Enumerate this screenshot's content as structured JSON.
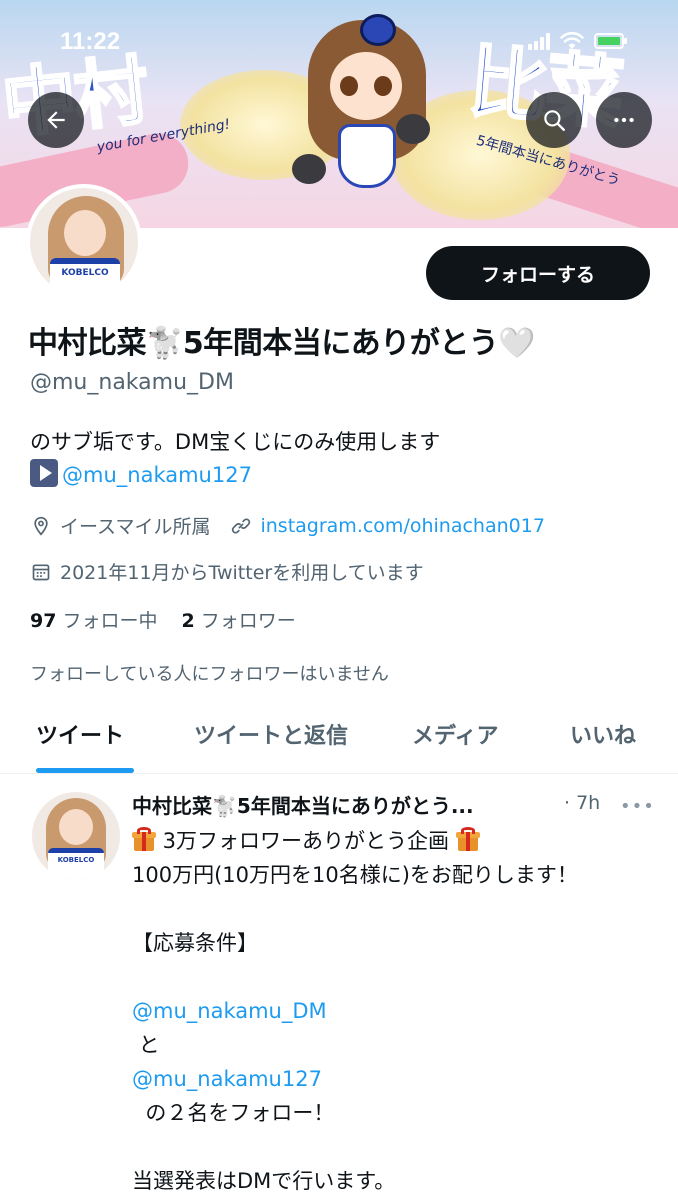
{
  "status_bar": {
    "time": "11:22"
  },
  "banner": {
    "title_left": "中村",
    "title_right": "比菜",
    "caption_left": "you for everything!",
    "caption_right": "5年間本当にありがとう"
  },
  "profile": {
    "avatar_logo": "KOBELCO",
    "follow_button": "フォローする",
    "display_name": "中村比菜🐩5年間本当にありがとう🤍",
    "handle": "@mu_nakamu_DM",
    "bio_line1": "のサブ垢です。DM宝くじにのみ使用します",
    "bio_link": "@mu_nakamu127",
    "location": "イースマイル所属",
    "website": "instagram.com/ohinachan017",
    "joined": "2021年11月からTwitterを利用しています",
    "following_count": "97",
    "following_label": "フォロー中",
    "followers_count": "2",
    "followers_label": "フォロワー",
    "followers_note": "フォローしている人にフォロワーはいません"
  },
  "tabs": [
    {
      "label": "ツイート"
    },
    {
      "label": "ツイートと返信"
    },
    {
      "label": "メディア"
    },
    {
      "label": "いいね"
    }
  ],
  "tweet": {
    "author": "中村比菜🐩5年間本当にありがとう...",
    "time": "· 7h",
    "more": "•••",
    "line1": " 3万フォロワーありがとう企画 ",
    "line2": "100万円(10万円を10名様に)をお配りします！",
    "line3": "【応募条件】",
    "line4": "@mu_nakamu_DM",
    "line5": " と",
    "line6": "@mu_nakamu127",
    "line7": "  の２名をフォロー！",
    "line8": "当選発表はDMで行います。"
  },
  "colors": {
    "accent": "#1d9bf0",
    "text": "#0f1419",
    "secondary": "#536471",
    "button": "#0f1419"
  },
  "icons": {
    "back": "arrow-left-icon",
    "search": "search-icon",
    "more": "more-horizontal-icon",
    "location": "location-pin-icon",
    "link": "link-icon",
    "calendar": "calendar-icon"
  }
}
